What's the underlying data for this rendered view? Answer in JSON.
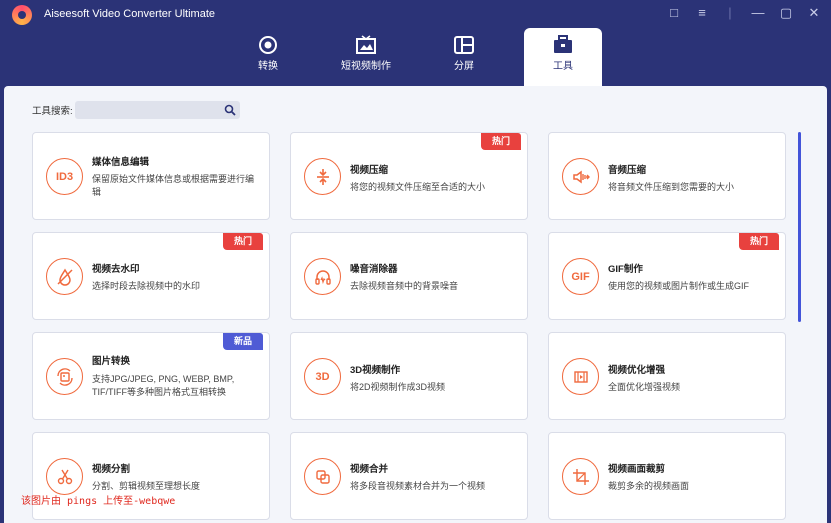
{
  "app": {
    "title": "Aiseesoft Video Converter Ultimate"
  },
  "nav": {
    "tabs": [
      {
        "label": "转换",
        "icon": "convert-icon"
      },
      {
        "label": "短视频制作",
        "icon": "mv-icon"
      },
      {
        "label": "分屏",
        "icon": "collage-icon"
      },
      {
        "label": "工具",
        "icon": "toolbox-icon"
      }
    ],
    "active": "工具"
  },
  "search": {
    "label": "工具搜索:",
    "placeholder": ""
  },
  "tools": [
    {
      "title": "媒体信息编辑",
      "desc": "保留原始文件媒体信息或根据需要进行编辑",
      "icon_text": "ID3",
      "icon": "id3-icon",
      "badge": ""
    },
    {
      "title": "视频压缩",
      "desc": "将您的视频文件压缩至合适的大小",
      "icon_text": "",
      "icon": "compress-icon",
      "badge": "热门"
    },
    {
      "title": "音频压缩",
      "desc": "将音频文件压缩到您需要的大小",
      "icon_text": "",
      "icon": "audio-compress-icon",
      "badge": ""
    },
    {
      "title": "视频去水印",
      "desc": "选择时段去除视频中的水印",
      "icon_text": "",
      "icon": "watermark-remove-icon",
      "badge": "热门"
    },
    {
      "title": "噪音消除器",
      "desc": "去除视频音频中的背景噪音",
      "icon_text": "",
      "icon": "noise-remove-icon",
      "badge": ""
    },
    {
      "title": "GIF制作",
      "desc": "使用您的视频或图片制作或生成GIF",
      "icon_text": "GIF",
      "icon": "gif-icon",
      "badge": "热门"
    },
    {
      "title": "图片转换",
      "desc": "支持JPG/JPEG, PNG, WEBP, BMP, TIF/TIFF等多种图片格式互相转换",
      "icon_text": "",
      "icon": "image-convert-icon",
      "badge": "新品"
    },
    {
      "title": "3D视频制作",
      "desc": "将2D视频制作成3D视频",
      "icon_text": "3D",
      "icon": "3d-icon",
      "badge": ""
    },
    {
      "title": "视频优化增强",
      "desc": "全面优化增强视频",
      "icon_text": "",
      "icon": "enhance-icon",
      "badge": ""
    },
    {
      "title": "视频分割",
      "desc": "分割、剪辑视频至理想长度",
      "icon_text": "",
      "icon": "scissors-icon",
      "badge": ""
    },
    {
      "title": "视频合并",
      "desc": "将多段音视频素材合并为一个视频",
      "icon_text": "",
      "icon": "merge-icon",
      "badge": ""
    },
    {
      "title": "视频画面裁剪",
      "desc": "裁剪多余的视频画面",
      "icon_text": "",
      "icon": "crop-icon",
      "badge": ""
    }
  ],
  "watermark": "该图片由 pings 上传至-webqwe",
  "colors": {
    "header": "#2b3377",
    "accent": "#f06a3e",
    "hot": "#e8413e",
    "new": "#4f5bd5"
  }
}
